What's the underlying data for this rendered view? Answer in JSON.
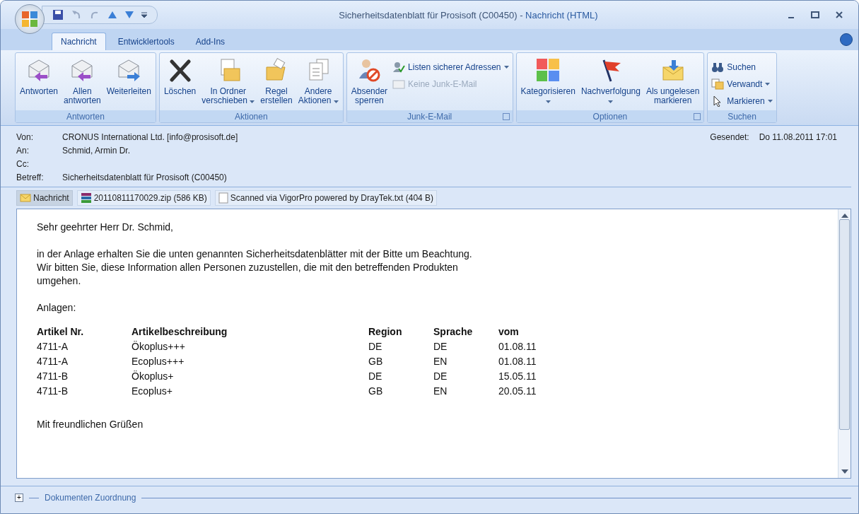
{
  "window": {
    "title": "Sicherheitsdatenblatt für Prosisoft (C00450)",
    "separator": "-",
    "app_title": "Nachricht (HTML)"
  },
  "tabs": [
    {
      "label": "Nachricht",
      "selected": true
    },
    {
      "label": "Entwicklertools",
      "selected": false
    },
    {
      "label": "Add-Ins",
      "selected": false
    }
  ],
  "ribbon": [
    {
      "label": "Antworten",
      "buttons": [
        {
          "kind": "large",
          "lines": [
            "Antworten"
          ]
        },
        {
          "kind": "large",
          "lines": [
            "Allen",
            "antworten"
          ]
        },
        {
          "kind": "large",
          "lines": [
            "Weiterleiten"
          ]
        }
      ]
    },
    {
      "label": "Aktionen",
      "buttons": [
        {
          "kind": "large",
          "lines": [
            "Löschen"
          ]
        },
        {
          "kind": "large",
          "lines": [
            "In Ordner",
            "verschieben"
          ],
          "dropdown": true
        },
        {
          "kind": "large",
          "lines": [
            "Regel",
            "erstellen"
          ]
        },
        {
          "kind": "large",
          "lines": [
            "Andere",
            "Aktionen"
          ],
          "dropdown": true
        }
      ]
    },
    {
      "label": "Junk-E-Mail",
      "launcher": true,
      "buttons": [
        {
          "kind": "large",
          "lines": [
            "Absender",
            "sperren"
          ]
        },
        {
          "kind": "small",
          "lines": [
            "Listen sicherer Adressen"
          ],
          "dropdown": true
        },
        {
          "kind": "small",
          "lines": [
            "Keine Junk-E-Mail"
          ],
          "disabled": true
        }
      ]
    },
    {
      "label": "Optionen",
      "launcher": true,
      "buttons": [
        {
          "kind": "large",
          "lines": [
            "Kategorisieren"
          ],
          "dropdown": true
        },
        {
          "kind": "large",
          "lines": [
            "Nachverfolgung"
          ],
          "dropdown": true
        },
        {
          "kind": "large",
          "lines": [
            "Als ungelesen",
            "markieren"
          ]
        }
      ]
    },
    {
      "label": "Suchen",
      "buttons": [
        {
          "kind": "small",
          "lines": [
            "Suchen"
          ]
        },
        {
          "kind": "small",
          "lines": [
            "Verwandt"
          ],
          "dropdown": true
        },
        {
          "kind": "small",
          "lines": [
            "Markieren"
          ],
          "dropdown": true
        }
      ]
    }
  ],
  "header": {
    "fields": [
      {
        "label": "Von:",
        "value": "CRONUS International Ltd. [info@prosisoft.de]"
      },
      {
        "label": "An:",
        "value": "Schmid, Armin Dr."
      },
      {
        "label": "Cc:"
      },
      {
        "label": "Betreff:",
        "value": "Sicherheitsdatenblatt für Prosisoft (C00450)"
      }
    ],
    "sent": {
      "label": "Gesendet:",
      "value": "Do 11.08.2011 17:01"
    }
  },
  "attachments": [
    {
      "kind": "message",
      "name": "Nachricht",
      "selected": true
    },
    {
      "kind": "zip",
      "name": "20110811170029.zip (586 KB)",
      "selected": false
    },
    {
      "kind": "text",
      "name": "Scanned via VigorPro powered by DrayTek.txt (404 B)",
      "selected": false
    }
  ],
  "body": {
    "greeting": "Sehr geehrter Herr Dr. Schmid,",
    "paragraph": [
      "in der Anlage erhalten Sie die unten genannten Sicherheitsdatenblätter mit der Bitte um Beachtung.",
      "Wir bitten Sie, diese Information allen Personen zuzustellen, die mit den betreffenden Produkten",
      "umgehen."
    ],
    "attachments_label": "Anlagen:",
    "table": {
      "columns": [
        "Artikel Nr.",
        "Artikelbeschreibung",
        "Region",
        "Sprache",
        "vom"
      ],
      "rows": [
        [
          "4711-A",
          "Ökoplus+++",
          "DE",
          "DE",
          "01.08.11"
        ],
        [
          "4711-A",
          "Ecoplus+++",
          "GB",
          "EN",
          "01.08.11"
        ],
        [
          "4711-B",
          "Ökoplus+",
          "DE",
          "DE",
          "15.05.11"
        ],
        [
          "4711-B",
          "Ecoplus+",
          "GB",
          "EN",
          "20.05.11"
        ]
      ]
    },
    "closing": "Mit freundlichen Grüßen"
  },
  "footer": {
    "toggle": "+",
    "section": "Dokumenten Zuordnung"
  }
}
